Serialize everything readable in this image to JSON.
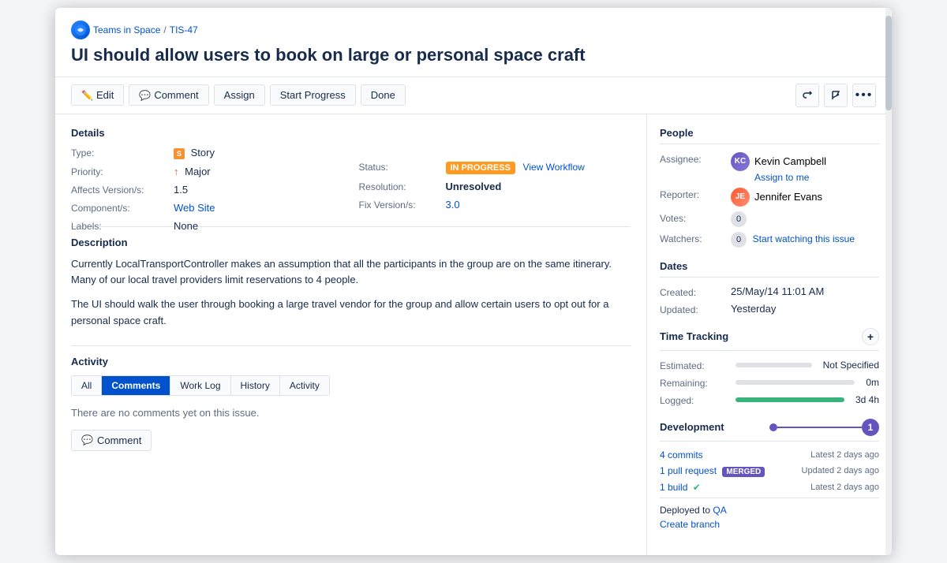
{
  "breadcrumb": {
    "project_name": "Teams in Space",
    "separator": "/",
    "issue_id": "TIS-47"
  },
  "issue": {
    "title": "UI should allow users to book on large or personal space craft"
  },
  "toolbar": {
    "edit_label": "Edit",
    "comment_label": "Comment",
    "assign_label": "Assign",
    "start_progress_label": "Start Progress",
    "done_label": "Done"
  },
  "details": {
    "section_title": "Details",
    "type_label": "Type:",
    "type_value": "Story",
    "priority_label": "Priority:",
    "priority_value": "Major",
    "affects_label": "Affects Version/s:",
    "affects_value": "1.5",
    "components_label": "Component/s:",
    "components_value": "Web Site",
    "labels_label": "Labels:",
    "labels_value": "None",
    "status_label": "Status:",
    "status_value": "IN PROGRESS",
    "view_workflow_label": "View Workflow",
    "resolution_label": "Resolution:",
    "resolution_value": "Unresolved",
    "fix_version_label": "Fix Version/s:",
    "fix_version_value": "3.0"
  },
  "description": {
    "section_title": "Description",
    "paragraph1": "Currently LocalTransportController makes an assumption that all the participants in the group are on the same itinerary. Many of our local travel providers limit reservations to 4 people.",
    "paragraph2": "The UI should walk the user through booking a large travel vendor for the group and allow certain users to opt out for a personal space craft."
  },
  "activity": {
    "section_title": "Activity",
    "tabs": [
      {
        "id": "all",
        "label": "All"
      },
      {
        "id": "comments",
        "label": "Comments",
        "active": true
      },
      {
        "id": "worklog",
        "label": "Work Log"
      },
      {
        "id": "history",
        "label": "History"
      },
      {
        "id": "activity",
        "label": "Activity"
      }
    ],
    "no_comments_text": "There are no comments yet on this issue.",
    "comment_button_label": "Comment"
  },
  "people": {
    "section_title": "People",
    "assignee_label": "Assignee:",
    "assignee_name": "Kevin Campbell",
    "assignee_initials": "KC",
    "assign_to_me": "Assign to me",
    "reporter_label": "Reporter:",
    "reporter_name": "Jennifer Evans",
    "reporter_initials": "JE",
    "votes_label": "Votes:",
    "votes_count": "0",
    "watchers_label": "Watchers:",
    "watchers_count": "0",
    "start_watching": "Start watching this issue"
  },
  "dates": {
    "section_title": "Dates",
    "created_label": "Created:",
    "created_value": "25/May/14 11:01 AM",
    "updated_label": "Updated:",
    "updated_value": "Yesterday"
  },
  "time_tracking": {
    "section_title": "Time Tracking",
    "add_icon": "+",
    "estimated_label": "Estimated:",
    "estimated_value": "Not Specified",
    "remaining_label": "Remaining:",
    "remaining_value": "0m",
    "logged_label": "Logged:",
    "logged_value": "3d 4h"
  },
  "development": {
    "section_title": "Development",
    "badge_number": "1",
    "commits_label": "4 commits",
    "commits_time": "Latest 2 days ago",
    "pull_request_label": "1 pull request",
    "pull_request_badge": "MERGED",
    "pull_request_time": "Updated 2 days ago",
    "build_label": "1 build",
    "build_time": "Latest 2 days ago",
    "deployed_text": "Deployed",
    "deployed_to": "to",
    "deployed_env": "QA",
    "create_branch_label": "Create branch"
  }
}
